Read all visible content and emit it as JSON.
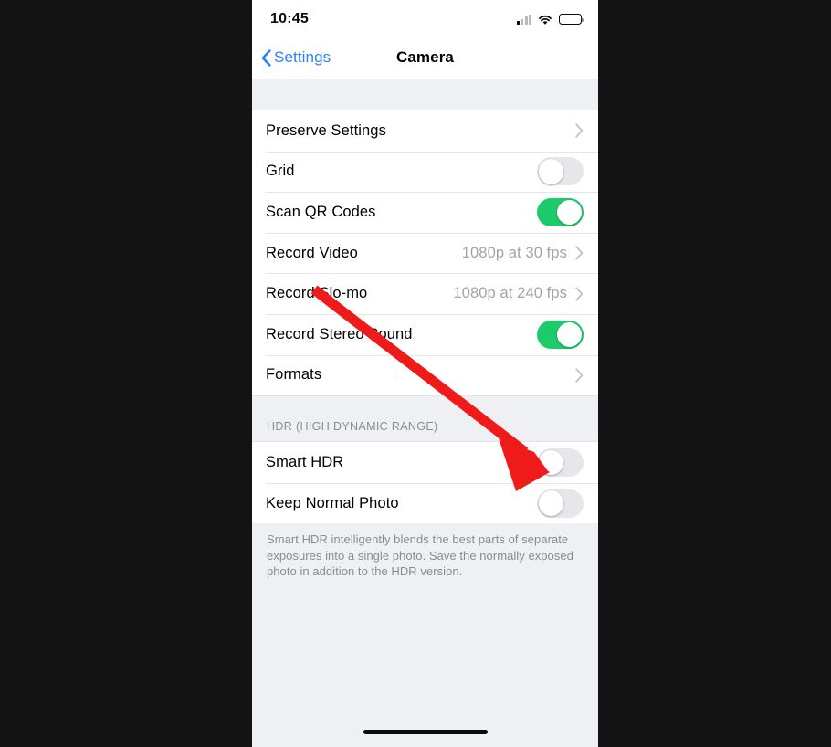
{
  "status_bar": {
    "time": "10:45",
    "cellular_icon": "cellular-signal-icon",
    "wifi_icon": "wifi-icon",
    "battery_icon": "battery-full-icon"
  },
  "nav": {
    "back_label": "Settings",
    "back_icon": "chevron-left-icon",
    "title": "Camera"
  },
  "sections": [
    {
      "rows": [
        {
          "label": "Preserve Settings",
          "type": "disclosure",
          "value": ""
        },
        {
          "label": "Grid",
          "type": "toggle",
          "state": "off"
        },
        {
          "label": "Scan QR Codes",
          "type": "toggle",
          "state": "on"
        },
        {
          "label": "Record Video",
          "type": "disclosure",
          "value": "1080p at 30 fps"
        },
        {
          "label": "Record Slo-mo",
          "type": "disclosure",
          "value": "1080p at 240 fps"
        },
        {
          "label": "Record Stereo Sound",
          "type": "toggle",
          "state": "on"
        },
        {
          "label": "Formats",
          "type": "disclosure",
          "value": ""
        }
      ]
    },
    {
      "header": "HDR (HIGH DYNAMIC RANGE)",
      "rows": [
        {
          "label": "Smart HDR",
          "type": "toggle",
          "state": "off"
        },
        {
          "label": "Keep Normal Photo",
          "type": "toggle",
          "state": "off"
        }
      ],
      "footer": "Smart HDR intelligently blends the best parts of separate exposures into a single photo. Save the normally exposed photo in addition to the HDR version."
    }
  ],
  "annotation": {
    "arrow_icon": "red-arrow-annotation",
    "color": "#ef1b1b",
    "points_to": "Smart HDR"
  },
  "colors": {
    "accent_blue": "#2d7ff5",
    "toggle_on_green": "#1ecb6b",
    "toggle_off_gray": "#e6e6eb",
    "group_background": "#eff0f4",
    "secondary_text": "#8b8b90"
  },
  "home_indicator": "home-indicator-bar"
}
